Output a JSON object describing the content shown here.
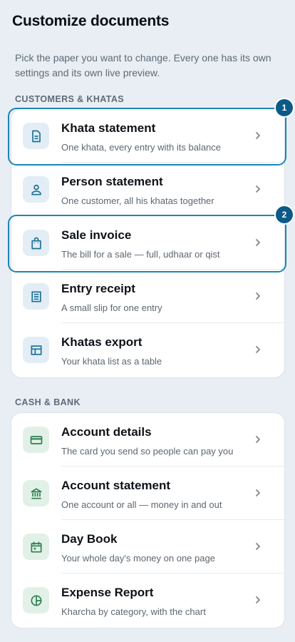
{
  "header": {
    "title": "Customize documents",
    "intro": "Pick the paper you want to change. Every one has its own settings and its own live preview."
  },
  "sections": [
    {
      "label": "CUSTOMERS & KHATAS",
      "items": [
        {
          "title": "Khata statement",
          "subtitle": "One khata, every entry with its balance",
          "icon": "document-icon"
        },
        {
          "title": "Person statement",
          "subtitle": "One customer, all his khatas together",
          "icon": "person-icon"
        },
        {
          "title": "Sale invoice",
          "subtitle": "The bill for a sale — full, udhaar or qist",
          "icon": "shopping-bag-icon"
        },
        {
          "title": "Entry receipt",
          "subtitle": "A small slip for one entry",
          "icon": "receipt-icon"
        },
        {
          "title": "Khatas export",
          "subtitle": "Your khata list as a table",
          "icon": "table-icon"
        }
      ]
    },
    {
      "label": "CASH & BANK",
      "items": [
        {
          "title": "Account details",
          "subtitle": "The card you send so people can pay you",
          "icon": "credit-card-icon"
        },
        {
          "title": "Account statement",
          "subtitle": "One account or all — money in and out",
          "icon": "bank-icon"
        },
        {
          "title": "Day Book",
          "subtitle": "Your whole day's money on one page",
          "icon": "calendar-icon"
        },
        {
          "title": "Expense Report",
          "subtitle": "Kharcha by category, with the chart",
          "icon": "pie-chart-icon"
        }
      ]
    }
  ],
  "markers": [
    "1",
    "2"
  ],
  "colors": {
    "background": "#e8eef3",
    "accent_blue": "#1b84b8",
    "marker": "#0c5a88",
    "icon_blue": "#1f6f96",
    "icon_green": "#2e7d4f"
  }
}
